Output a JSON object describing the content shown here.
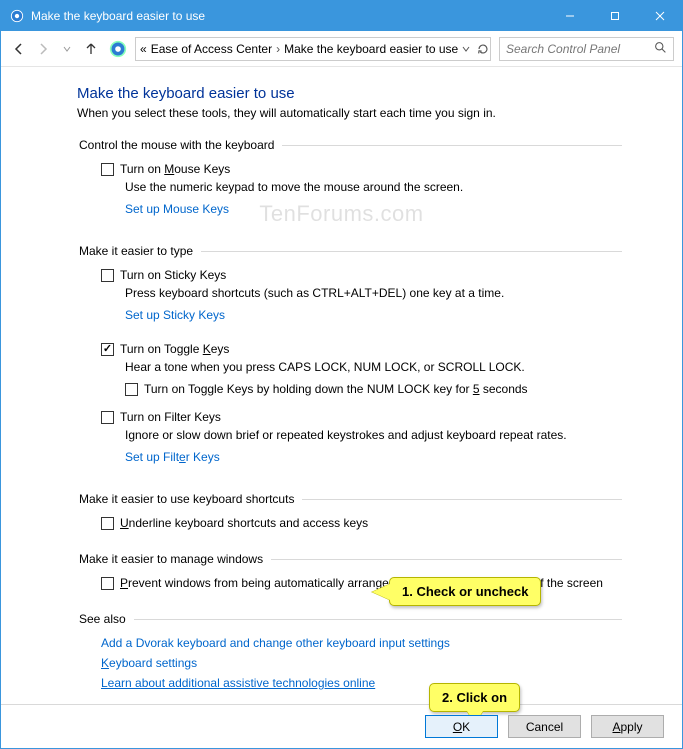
{
  "window": {
    "title": "Make the keyboard easier to use"
  },
  "breadcrumb": {
    "prefix": "«",
    "item1": "Ease of Access Center",
    "item2": "Make the keyboard easier to use"
  },
  "search": {
    "placeholder": "Search Control Panel"
  },
  "page": {
    "title": "Make the keyboard easier to use",
    "subtitle": "When you select these tools, they will automatically start each time you sign in."
  },
  "group1": {
    "legend": "Control the mouse with the keyboard",
    "chk1_pre": "Turn on ",
    "chk1_u": "M",
    "chk1_post": "ouse Keys",
    "desc": "Use the numeric keypad to move the mouse around the screen.",
    "link": "Set up Mouse Keys"
  },
  "group2": {
    "legend": "Make it easier to type",
    "sticky_label": "Turn on Sticky Keys",
    "sticky_desc": "Press keyboard shortcuts (such as CTRL+ALT+DEL) one key at a time.",
    "sticky_link": "Set up Sticky Keys",
    "toggle_pre": "Turn on Toggle ",
    "toggle_u": "K",
    "toggle_post": "eys",
    "toggle_desc": "Hear a tone when you press CAPS LOCK, NUM LOCK, or SCROLL LOCK.",
    "toggle_hold_pre": "Turn on Toggle Keys by holding down the NUM LOCK key for ",
    "toggle_hold_u": "5",
    "toggle_hold_post": " seconds",
    "filter_label": "Turn on Filter Keys",
    "filter_desc": "Ignore or slow down brief or repeated keystrokes and adjust keyboard repeat rates.",
    "filter_link_pre": "Set up Filt",
    "filter_link_u": "e",
    "filter_link_post": "r Keys"
  },
  "group3": {
    "legend": "Make it easier to use keyboard shortcuts",
    "chk_u": "U",
    "chk_post": "nderline keyboard shortcuts and access keys"
  },
  "group4": {
    "legend": "Make it easier to manage windows",
    "chk_u": "P",
    "chk_post": "revent windows from being automatically arranged when moved to the edge of the screen"
  },
  "seealso": {
    "legend": "See also",
    "l1": "Add a Dvorak keyboard and change other keyboard input settings",
    "l2_u": "K",
    "l2_post": "eyboard settings",
    "l3": "Learn about additional assistive technologies online"
  },
  "buttons": {
    "ok_u": "O",
    "ok_post": "K",
    "cancel": "Cancel",
    "apply_u": "A",
    "apply_post": "pply"
  },
  "callouts": {
    "c1": "1. Check or uncheck",
    "c2": "2. Click on"
  },
  "watermark": "TenForums.com"
}
